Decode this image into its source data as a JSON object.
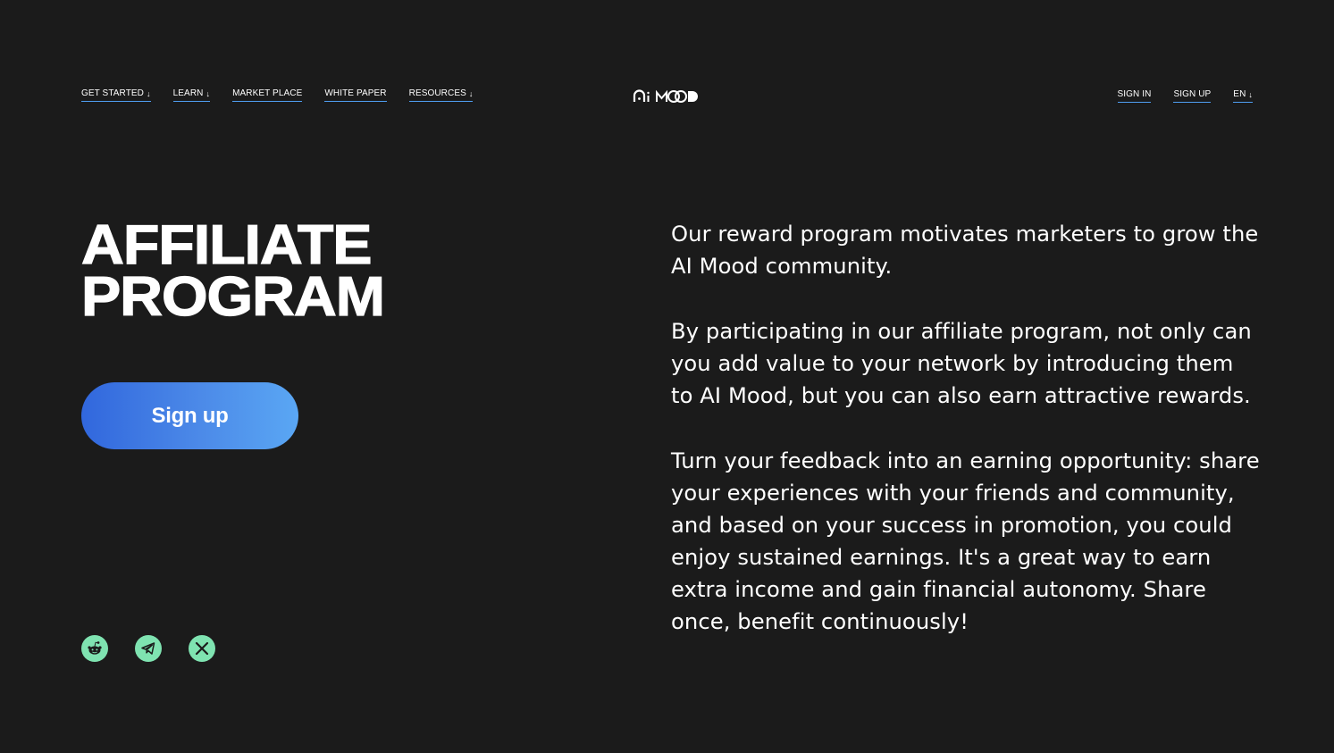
{
  "nav": {
    "left_items": [
      {
        "label": "GET STARTED",
        "has_arrow": true
      },
      {
        "label": "LEARN",
        "has_arrow": true
      },
      {
        "label": "MARKET PLACE",
        "has_arrow": false
      },
      {
        "label": "WHITE PAPER",
        "has_arrow": false
      },
      {
        "label": "RESOURCES",
        "has_arrow": true
      }
    ],
    "right_items": [
      {
        "label": "SIGN IN",
        "has_arrow": false
      },
      {
        "label": "SIGN UP",
        "has_arrow": false
      },
      {
        "label": "EN",
        "has_arrow": true
      }
    ],
    "arrow_glyph": "↓",
    "underline_color": "#4f9df0"
  },
  "logo": {
    "text": "Ai MOOD",
    "icon": "ai-mood-logo"
  },
  "hero": {
    "title_line1": "AFFILIATE",
    "title_line2": "PROGRAM",
    "signup_label": "Sign up",
    "button_gradient": [
      "#3167dd",
      "#5aa7f4"
    ]
  },
  "socials": [
    {
      "icon": "reddit-icon"
    },
    {
      "icon": "telegram-icon"
    },
    {
      "icon": "x-icon"
    }
  ],
  "social_color": "#7fe3b1",
  "description": {
    "p1": "Our reward program motivates marketers to grow the AI Mood community.",
    "p2": "By participating in our affiliate program, not only can you add value to your network by introducing them to AI Mood, but you can also earn attractive rewards.",
    "p3": "Turn your feedback into an earning opportunity: share your experiences with your friends and community, and based on your success in promotion, you could enjoy sustained earnings. It's a great way to earn extra income and gain financial autonomy. Share once, benefit continuously!"
  },
  "colors": {
    "background": "#1b1b1b",
    "text": "#ffffff"
  }
}
